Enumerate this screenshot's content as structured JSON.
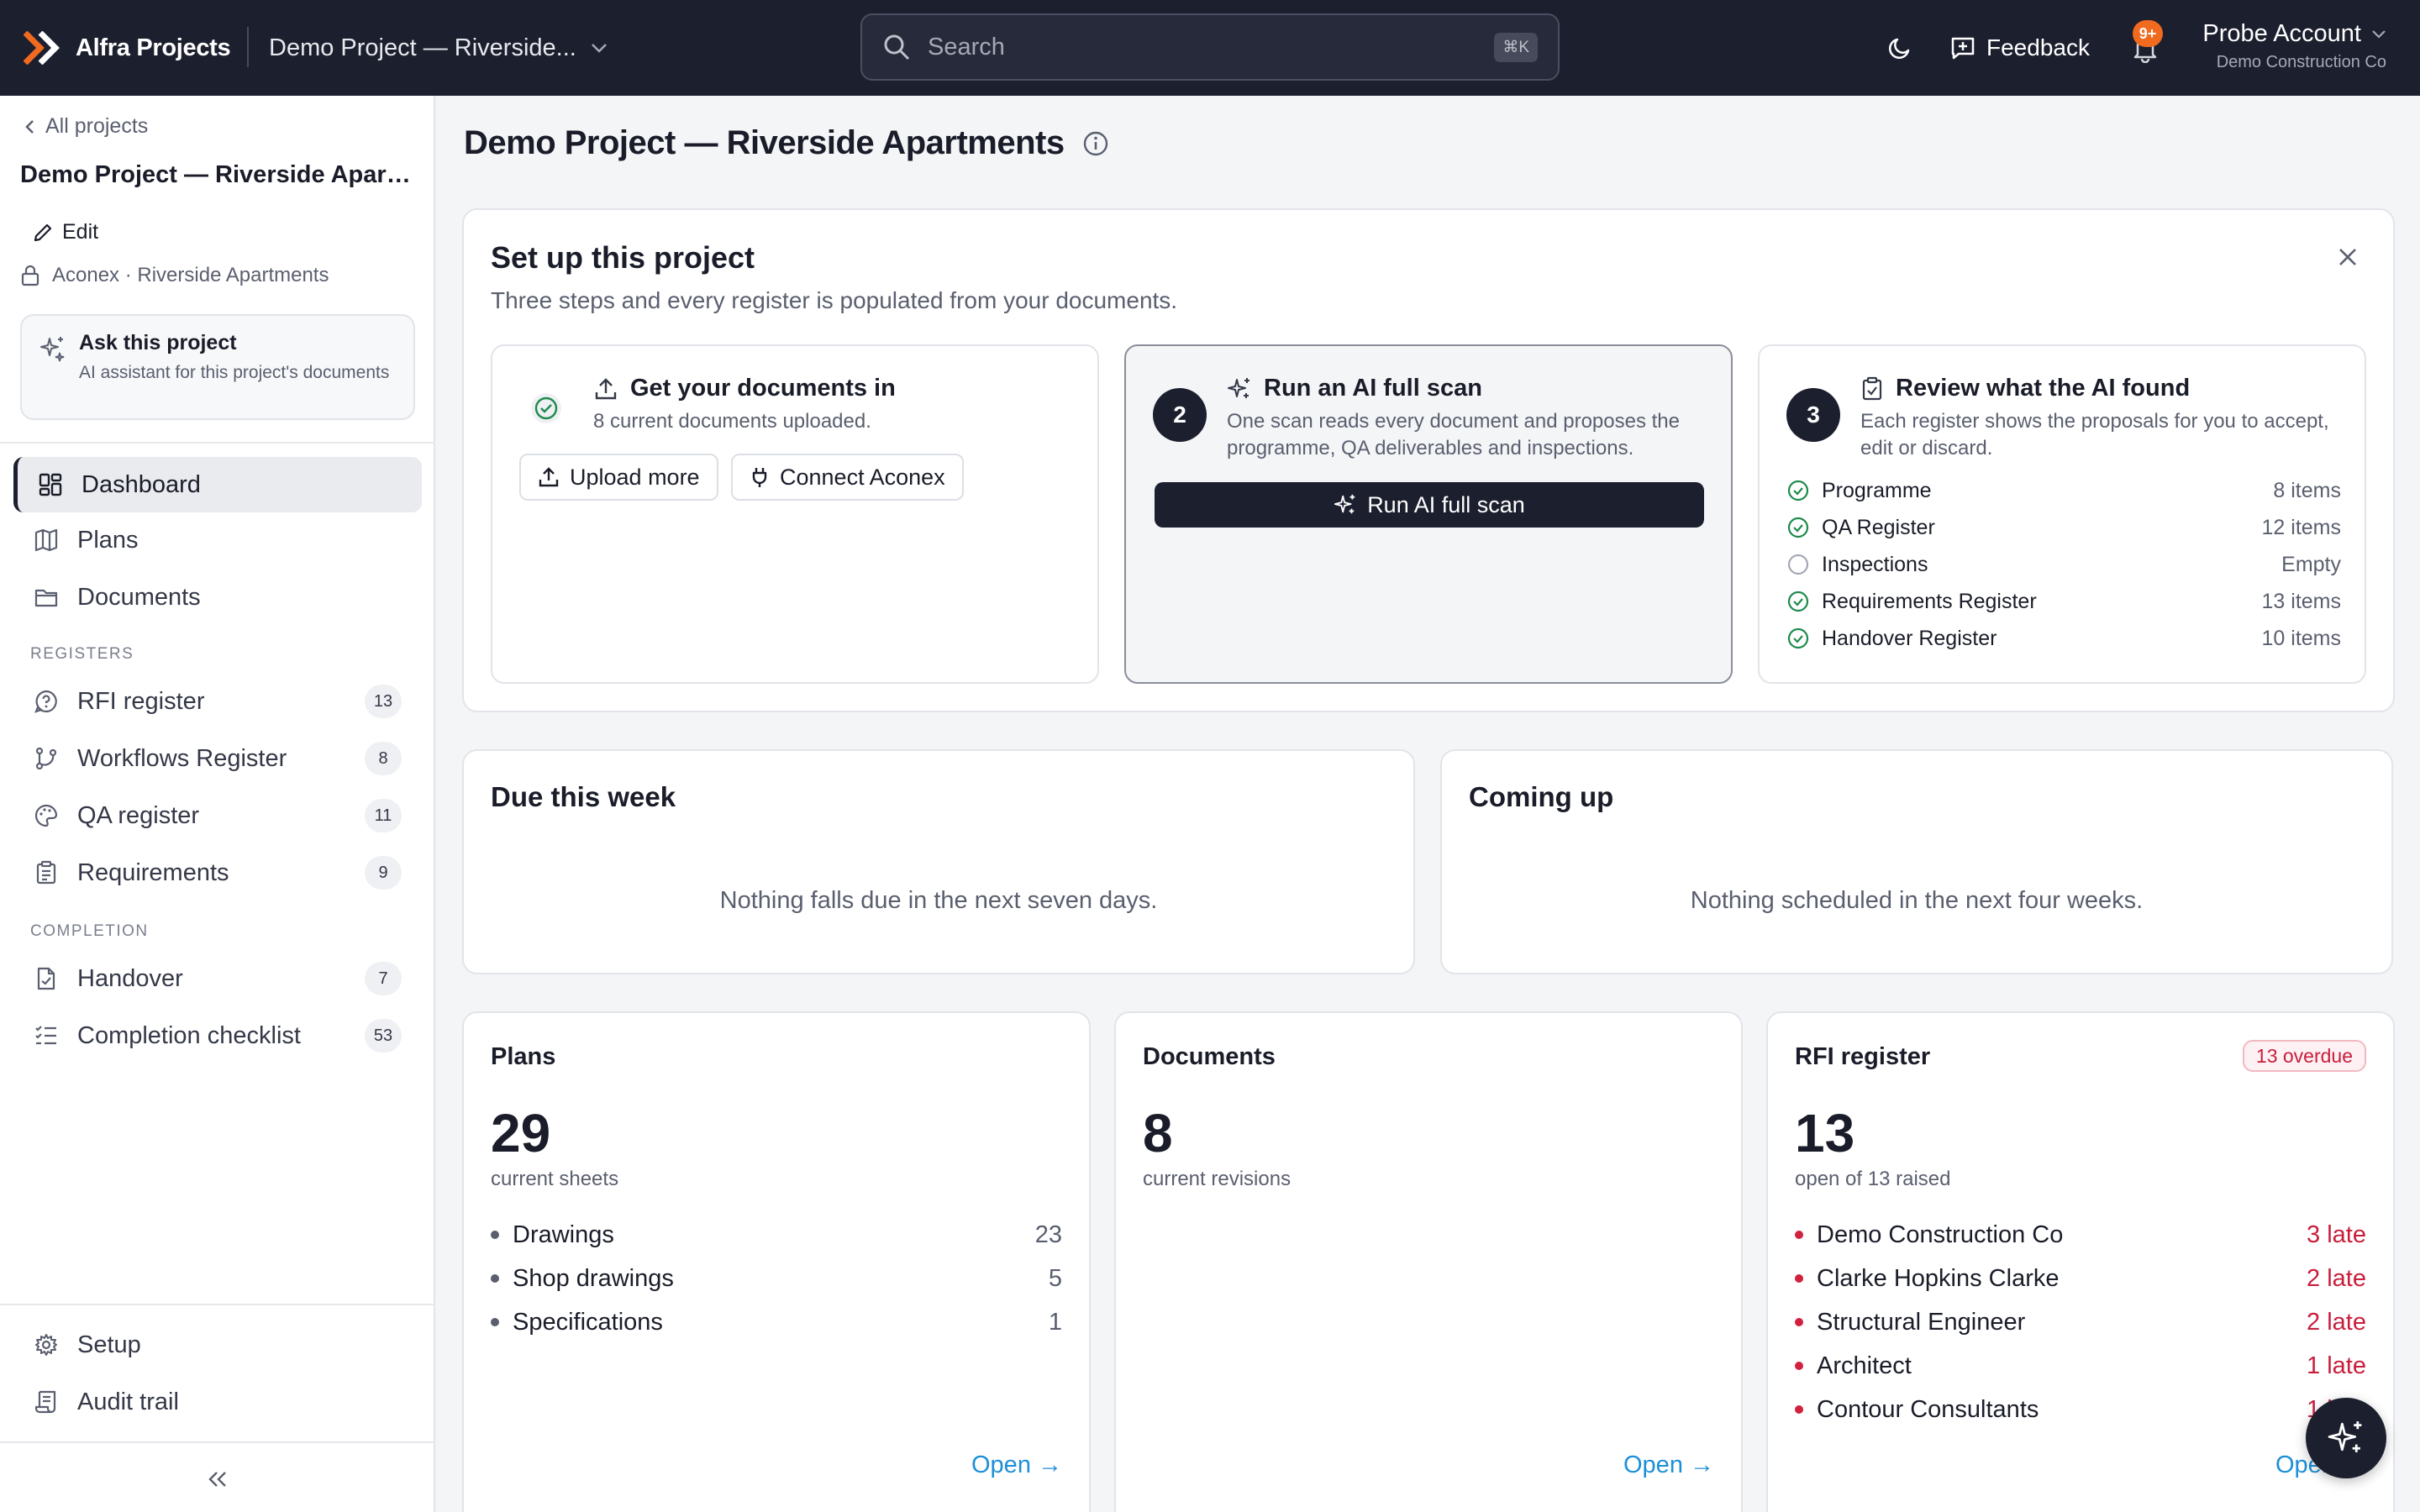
{
  "topbar": {
    "brand": "Alfra Projects",
    "project_select": "Demo Project — Riverside...",
    "search_placeholder": "Search",
    "search_shortcut": "⌘K",
    "feedback_label": "Feedback",
    "notifications_badge": "9+",
    "account_name": "Probe Account",
    "account_org": "Demo Construction Co"
  },
  "sidebar": {
    "back_label": "All projects",
    "project_title": "Demo Project — Riverside Apartments",
    "edit_label": "Edit",
    "source_label": "Aconex · Riverside Apartments",
    "ask_title": "Ask this project",
    "ask_subtitle": "AI assistant for this project's documents",
    "nav": [
      {
        "label": "Dashboard",
        "icon": "dashboard-icon"
      },
      {
        "label": "Plans",
        "icon": "map-icon"
      },
      {
        "label": "Documents",
        "icon": "folder-icon"
      }
    ],
    "registers_label": "REGISTERS",
    "registers": [
      {
        "label": "RFI register",
        "count": "13",
        "icon": "question-circle-icon"
      },
      {
        "label": "Workflows Register",
        "count": "8",
        "icon": "workflow-icon"
      },
      {
        "label": "QA register",
        "count": "11",
        "icon": "palette-icon"
      },
      {
        "label": "Requirements",
        "count": "9",
        "icon": "clipboard-list-icon"
      }
    ],
    "completion_label": "COMPLETION",
    "completion": [
      {
        "label": "Handover",
        "count": "7",
        "icon": "file-check-icon"
      },
      {
        "label": "Completion checklist",
        "count": "53",
        "icon": "list-checks-icon"
      }
    ],
    "footer": [
      {
        "label": "Setup",
        "icon": "gear-icon"
      },
      {
        "label": "Audit trail",
        "icon": "scroll-icon"
      }
    ]
  },
  "main": {
    "title": "Demo Project — Riverside Apartments",
    "setup": {
      "title": "Set up this project",
      "subtitle": "Three steps and every register is populated from your documents.",
      "step1": {
        "title": "Get your documents in",
        "desc": "8 current documents uploaded.",
        "upload_label": "Upload more",
        "connect_label": "Connect Aconex"
      },
      "step2": {
        "number": "2",
        "title": "Run an AI full scan",
        "desc": "One scan reads every document and proposes the programme, QA deliverables and inspections.",
        "button_label": "Run AI full scan"
      },
      "step3": {
        "number": "3",
        "title": "Review what the AI found",
        "desc": "Each register shows the proposals for you to accept, edit or discard.",
        "registers": [
          {
            "name": "Programme",
            "count": "8 items",
            "done": true
          },
          {
            "name": "QA Register",
            "count": "12 items",
            "done": true
          },
          {
            "name": "Inspections",
            "count": "Empty",
            "done": false
          },
          {
            "name": "Requirements Register",
            "count": "13 items",
            "done": true
          },
          {
            "name": "Handover Register",
            "count": "10 items",
            "done": true
          }
        ]
      }
    },
    "due_week": {
      "title": "Due this week",
      "empty": "Nothing falls due in the next seven days."
    },
    "coming_up": {
      "title": "Coming up",
      "empty": "Nothing scheduled in the next four weeks."
    },
    "plans": {
      "title": "Plans",
      "number": "29",
      "sub": "current sheets",
      "items": [
        {
          "label": "Drawings",
          "value": "23"
        },
        {
          "label": "Shop drawings",
          "value": "5"
        },
        {
          "label": "Specifications",
          "value": "1"
        }
      ],
      "open": "Open →"
    },
    "documents": {
      "title": "Documents",
      "number": "8",
      "sub": "current revisions",
      "open": "Open →"
    },
    "rfi": {
      "title": "RFI register",
      "badge": "13 overdue",
      "number": "13",
      "sub": "open of 13 raised",
      "items": [
        {
          "label": "Demo Construction Co",
          "value": "3 late"
        },
        {
          "label": "Clarke Hopkins Clarke",
          "value": "2 late"
        },
        {
          "label": "Structural Engineer",
          "value": "2 late"
        },
        {
          "label": "Architect",
          "value": "1 late"
        },
        {
          "label": "Contour Consultants",
          "value": "1 late"
        }
      ],
      "open": "Open →"
    }
  },
  "colors": {
    "topbar": "#1c1f2e",
    "accent_link": "#1d8fd8",
    "danger": "#c81e3c",
    "success": "#1e8a4c",
    "notif": "#f06a1f"
  }
}
